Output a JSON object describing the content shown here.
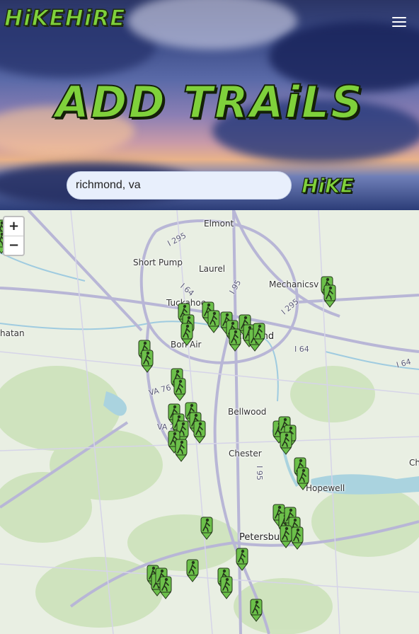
{
  "header": {
    "logo": "HiKEHiRE",
    "menu_icon": "hamburger-menu-icon",
    "title": "ADD TRAiLS"
  },
  "search": {
    "value": "richmond, va",
    "button_label": "HiKE"
  },
  "map": {
    "zoom_in": "+",
    "zoom_out": "−",
    "places": [
      "Elmont",
      "Short Pump",
      "Laurel",
      "Mechanicsv",
      "Tuckahoe",
      "Richmond",
      "Bon Air",
      "Bellwood",
      "Chester",
      "Hopewell",
      "Petersburg",
      "hatan",
      "Ch"
    ],
    "road_labels": [
      "I 295",
      "I 64",
      "I 95",
      "I 295",
      "I 64",
      "I 64",
      "VA 76",
      "VA 288",
      "I 95"
    ],
    "marker_icon": "hiker-marker-icon",
    "colors": {
      "marker": "#6cc04a",
      "water": "#aad3df",
      "park": "#c8dfb4",
      "road": "#b8b6d6"
    }
  }
}
